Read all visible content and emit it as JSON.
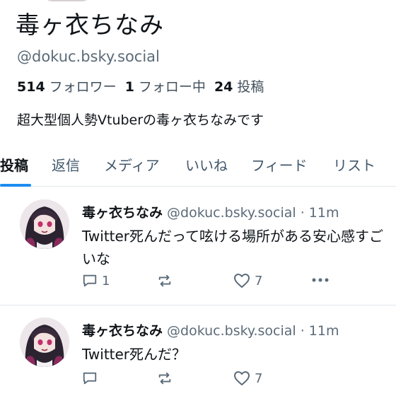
{
  "profile": {
    "display_name": "毒ヶ衣ちなみ",
    "handle": "@dokuc.bsky.social",
    "followers_count": "514",
    "followers_label": "フォロワー",
    "following_count": "1",
    "following_label": "フォロー中",
    "posts_count": "24",
    "posts_label": "投稿",
    "bio": "超大型個人勢Vtuberの毒ヶ衣ちなみです"
  },
  "tabs": [
    {
      "label": "投稿",
      "active": true
    },
    {
      "label": "返信"
    },
    {
      "label": "メディア"
    },
    {
      "label": "いいね"
    },
    {
      "label": "フィード"
    },
    {
      "label": "リスト"
    }
  ],
  "posts": [
    {
      "author": "毒ヶ衣ちなみ",
      "meta": "@dokuc.bsky.social · 11m",
      "text": "Twitter死んだって呟ける場所がある安心感すごいな",
      "replies": "1",
      "likes": "7"
    },
    {
      "author": "毒ヶ衣ちなみ",
      "meta": "@dokuc.bsky.social · 11m",
      "text": "Twitter死んだ？",
      "replies": "",
      "likes": "7"
    }
  ],
  "colors": {
    "accent": "#1d8cf0",
    "muted": "#5b6b79",
    "text": "#0f1419"
  },
  "icons": [
    "reply-icon",
    "repost-icon",
    "like-icon",
    "more-icon"
  ]
}
